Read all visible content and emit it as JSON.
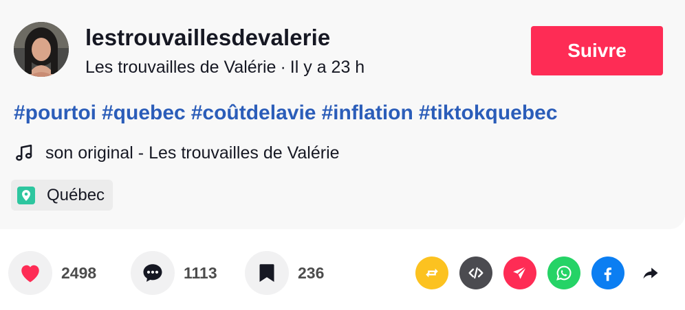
{
  "author": {
    "username": "lestrouvaillesdevalerie",
    "display_name": "Les trouvailles de Valérie",
    "separator": "·",
    "time_ago": "Il y a 23 h",
    "avatar_icon": "profile-photo"
  },
  "follow_button": {
    "label": "Suivre",
    "color": "#fe2c55"
  },
  "hashtags": [
    "#pourtoi",
    "#quebec",
    "#coûtdelavie",
    "#inflation",
    "#tiktokquebec"
  ],
  "music": {
    "icon": "music-note-icon",
    "label": "son original - Les trouvailles de Valérie"
  },
  "location": {
    "icon": "location-pin-icon",
    "label": "Québec",
    "icon_color": "#2dc69f"
  },
  "actions": {
    "likes": {
      "icon": "heart-icon",
      "count": "2498",
      "color": "#fe2c55"
    },
    "comments": {
      "icon": "comment-icon",
      "count": "1113"
    },
    "saves": {
      "icon": "bookmark-icon",
      "count": "236"
    }
  },
  "share_targets": [
    {
      "name": "repost",
      "icon": "repost-icon",
      "color": "#fcc220"
    },
    {
      "name": "embed",
      "icon": "embed-icon",
      "color": "#4b4b50"
    },
    {
      "name": "send",
      "icon": "send-icon",
      "color": "#fe2c55"
    },
    {
      "name": "whatsapp",
      "icon": "whatsapp-icon",
      "color": "#25d366"
    },
    {
      "name": "facebook",
      "icon": "facebook-icon",
      "color": "#0b7ef2"
    },
    {
      "name": "more-share",
      "icon": "share-arrow-icon",
      "color": "#161823"
    }
  ]
}
